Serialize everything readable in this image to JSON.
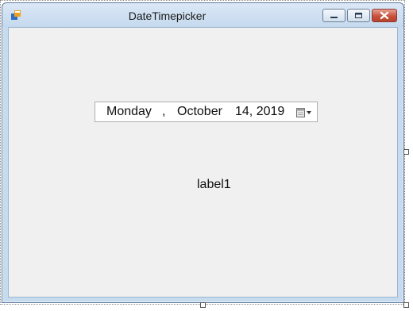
{
  "window": {
    "title": "DateTimepicker",
    "app_icon": "form-icon",
    "caption_buttons": [
      "minimize-icon",
      "maximize-icon",
      "close-icon"
    ]
  },
  "date_picker": {
    "day_of_week": "Monday",
    "separator": ",",
    "month": "October",
    "day_year": "14, 2019",
    "dropdown_icon": "calendar-dropdown-icon"
  },
  "label1": {
    "text": "label1"
  },
  "colors": {
    "titlebar": "#c7dbef",
    "client": "#f0f0f0",
    "close_button": "#c8523d"
  }
}
